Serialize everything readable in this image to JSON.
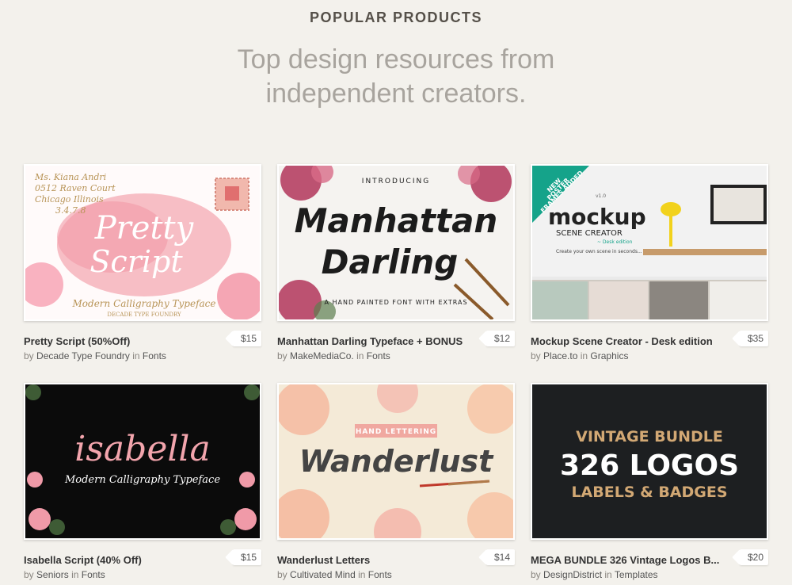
{
  "header": {
    "eyebrow": "POPULAR PRODUCTS",
    "headline_line1": "Top design resources from",
    "headline_line2": "independent creators."
  },
  "products": [
    {
      "title": "Pretty Script (50%Off)",
      "by": "by",
      "author": "Decade Type Foundry",
      "in": "in",
      "category": "Fonts",
      "price": "$15",
      "art": {
        "lines": [
          "Pretty",
          "Script"
        ],
        "subtitle": "Modern Calligraphy Typeface",
        "sub2": "DECADE TYPE FOUNDRY",
        "address": [
          "Ms. Kiana Andri",
          "0512 Raven Court",
          "Chicago Illinois",
          "3.4.7.8"
        ],
        "colors": {
          "wash": "#f6b7bf",
          "ink": "#ffffff",
          "gold": "#b89457"
        }
      }
    },
    {
      "title": "Manhattan Darling Typeface + BONUS",
      "by": "by",
      "author": "MakeMediaCo.",
      "in": "in",
      "category": "Fonts",
      "price": "$12",
      "art": {
        "kicker": "INTRODUCING",
        "lines": [
          "Manhattan",
          "Darling"
        ],
        "subtitle": "A HAND PAINTED FONT WITH EXTRAS",
        "colors": {
          "bg": "#f5f3f0",
          "ink": "#1c1c1c",
          "flower": "#b2355a"
        }
      }
    },
    {
      "title": "Mockup Scene Creator - Desk edition",
      "by": "by",
      "author": "Place.to",
      "in": "in",
      "category": "Graphics",
      "price": "$35",
      "art": {
        "ribbon": [
          "NEW",
          "POSTER",
          "FRAMES ADDED"
        ],
        "brand": "mockup",
        "brand_sub": "SCENE CREATOR",
        "edition": "~ Desk edition",
        "tagline": "Create your own scene in seconds...",
        "badge": "v1.0",
        "colors": {
          "ribbon": "#15a38a",
          "lamp": "#f2d21c",
          "ink": "#222"
        }
      }
    },
    {
      "title": "Isabella Script (40% Off)",
      "by": "by",
      "author": "Seniors",
      "in": "in",
      "category": "Fonts",
      "price": "$15",
      "art": {
        "lines": [
          "isabella"
        ],
        "subtitle": "Modern Calligraphy Typeface",
        "colors": {
          "bg": "#0b0b0b",
          "ink": "#f3a5ad",
          "sub": "#ffffff"
        }
      }
    },
    {
      "title": "Wanderlust Letters",
      "by": "by",
      "author": "Cultivated Mind",
      "in": "in",
      "category": "Fonts",
      "price": "$14",
      "art": {
        "banner": "HAND LETTERING",
        "lines": [
          "Wanderlust"
        ],
        "colors": {
          "bg": "#f4ead7",
          "ink": "#444",
          "banner": "#f0a8a0"
        }
      }
    },
    {
      "title": "MEGA BUNDLE 326 Vintage Logos B...",
      "by": "by",
      "author": "DesignDistrict",
      "in": "in",
      "category": "Templates",
      "price": "$20",
      "art": {
        "lines": [
          "VINTAGE BUNDLE",
          "326 LOGOS",
          "LABELS & BADGES"
        ],
        "colors": {
          "bg": "#1d1f21",
          "gold": "#d2a874",
          "white": "#ffffff"
        }
      }
    }
  ]
}
